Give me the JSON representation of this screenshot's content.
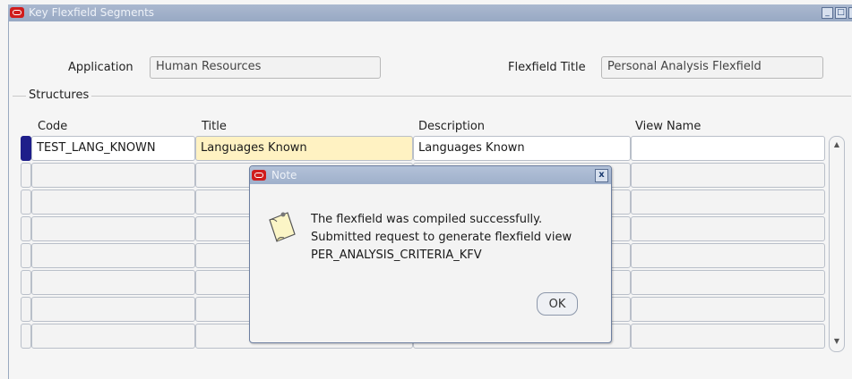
{
  "window": {
    "title": "Key Flexfield Segments",
    "minimize": "_",
    "maximize": "□",
    "close": "x"
  },
  "form": {
    "application_label": "Application",
    "application_value": "Human Resources",
    "flexfield_title_label": "Flexfield Title",
    "flexfield_title_value": "Personal Analysis Flexfield",
    "structures_label": "Structures"
  },
  "table": {
    "columns": [
      "Code",
      "Title",
      "Description",
      "View Name"
    ],
    "rows": [
      {
        "code": "TEST_LANG_KNOWN",
        "title": "Languages Known",
        "description": "Languages Known",
        "view_name": ""
      }
    ]
  },
  "dialog": {
    "title": "Note",
    "close": "x",
    "line1": "The flexfield was compiled successfully.",
    "line2": "Submitted request to generate flexfield view",
    "line3": "PER_ANALYSIS_CRITERIA_KFV",
    "ok_label": "OK",
    "icon": "note-icon"
  }
}
